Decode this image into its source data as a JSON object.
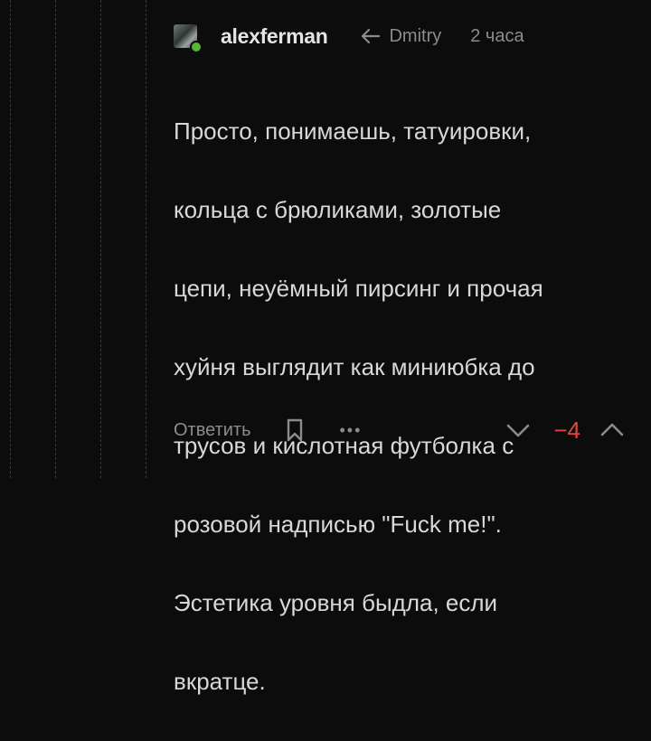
{
  "comment": {
    "username": "alexferman",
    "reply_to": "Dmitry",
    "time": "2 часа",
    "lines": [
      "Просто, понимаешь, татуировки,",
      "кольца с брюликами, золотые",
      "цепи, неуёмный пирсинг и прочая",
      "хуйня выглядит как миниюбка до",
      "трусов и кислотная футболка с",
      "розовой надписью \"Fuck me!\".",
      "Эстетика уровня быдла, если",
      "вкратце."
    ]
  },
  "footer": {
    "reply_label": "Ответить",
    "more_label": "•••",
    "rating": "−4"
  },
  "colors": {
    "background": "#0c0c0c",
    "online": "#5ab437",
    "negative_rating": "#e2463f"
  }
}
